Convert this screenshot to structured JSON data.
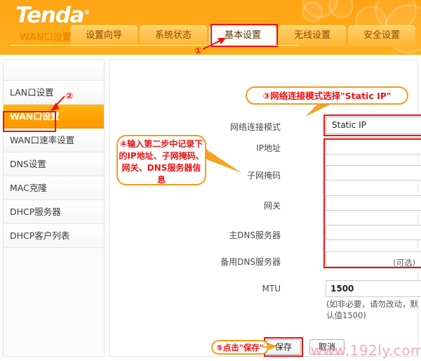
{
  "header": {
    "logo_text": "Tenda",
    "logo_mark": "®",
    "brand_color": "#ffa313"
  },
  "tabs": [
    {
      "label": "设置向导",
      "active": false
    },
    {
      "label": "系统状态",
      "active": false
    },
    {
      "label": "基本设置",
      "active": true
    },
    {
      "label": "无线设置",
      "active": false
    },
    {
      "label": "安全设置",
      "active": false
    }
  ],
  "sidebar": {
    "items": [
      {
        "label": "LAN口设置",
        "active": false
      },
      {
        "label": "WAN口设置",
        "active": true
      },
      {
        "label": "WAN口速率设置",
        "active": false
      },
      {
        "label": "DNS设置",
        "active": false
      },
      {
        "label": "MAC克隆",
        "active": false
      },
      {
        "label": "DHCP服务器",
        "active": false
      },
      {
        "label": "DHCP客户列表",
        "active": false
      }
    ]
  },
  "content": {
    "section_title": "WAN口设置",
    "fields": {
      "mode_label": "网络连接模式",
      "mode_value": "Static IP",
      "ip_label": "IP地址",
      "ip_value": "",
      "mask_label": "子网掩码",
      "mask_value": "",
      "gateway_label": "网关",
      "gateway_value": "",
      "dns1_label": "主DNS服务器",
      "dns1_value": "",
      "dns2_label": "备用DNS服务器",
      "dns2_value": "",
      "dns2_optional": "(可选)",
      "mtu_label": "MTU",
      "mtu_value": "1500",
      "mtu_hint": "(如非必要，请勿改动，默认值1500)"
    },
    "buttons": {
      "save": "保存",
      "cancel": "取消"
    }
  },
  "annotations": {
    "step1_num": "①",
    "step2_num": "②",
    "step3_text": "③网络连接模式选择\"Static IP\"",
    "step4_text": "④输入第二步中记录下的IP地址、子网掩码、网关、DNS服务器信息",
    "step5_text": "⑤点击\"保存\"",
    "highlight_color": "#ee1111",
    "callout_border_color": "#f59b1a"
  },
  "watermark": {
    "text": "www.192ly.com",
    "color": "#f7a9c8"
  }
}
